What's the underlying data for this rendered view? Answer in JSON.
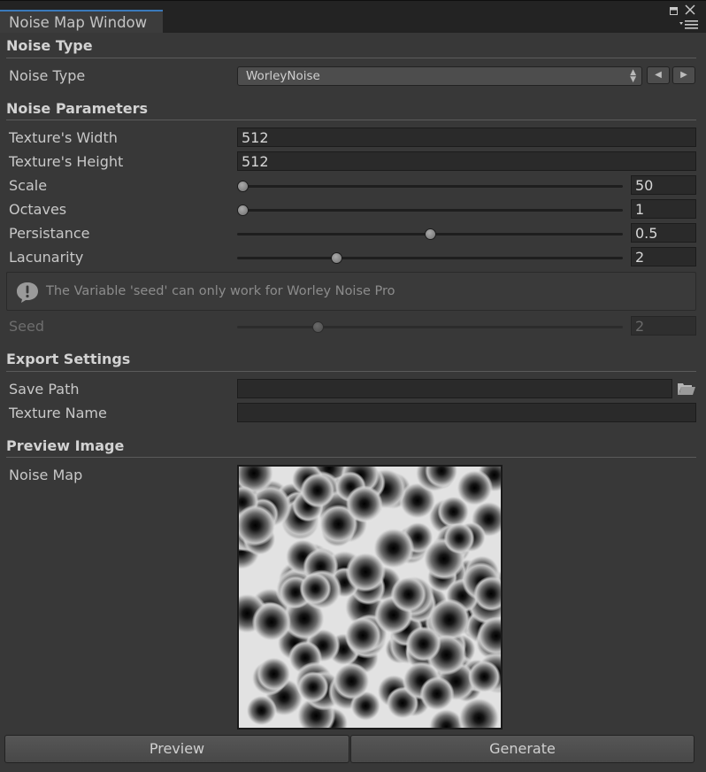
{
  "window": {
    "title": "Noise Map Window"
  },
  "noise_type_section": {
    "header": "Noise Type",
    "label": "Noise Type",
    "selected": "WorleyNoise"
  },
  "parameters_section": {
    "header": "Noise Parameters",
    "width_label": "Texture's Width",
    "width_value": "512",
    "height_label": "Texture's Height",
    "height_value": "512",
    "scale_label": "Scale",
    "scale_value": "50",
    "scale_fraction": 0.0,
    "octaves_label": "Octaves",
    "octaves_value": "1",
    "octaves_fraction": 0.0,
    "persistance_label": "Persistance",
    "persistance_value": "0.5",
    "persistance_fraction": 0.5,
    "lacunarity_label": "Lacunarity",
    "lacunarity_value": "2",
    "lacunarity_fraction": 0.25,
    "help_message": "The Variable 'seed' can only work for Worley Noise Pro",
    "seed_label": "Seed",
    "seed_value": "2",
    "seed_fraction": 0.2
  },
  "export_section": {
    "header": "Export Settings",
    "save_path_label": "Save Path",
    "save_path_value": "",
    "texture_name_label": "Texture Name",
    "texture_name_value": ""
  },
  "preview_section": {
    "header": "Preview Image",
    "label": "Noise Map"
  },
  "buttons": {
    "preview": "Preview",
    "generate": "Generate"
  },
  "colors": {
    "background": "#383838",
    "tab_accent": "#3a79bb",
    "field": "#2a2a2a"
  },
  "icons": [
    "maximize-icon",
    "close-icon",
    "menu-icon",
    "warning-icon",
    "folder-icon",
    "arrow-left-icon",
    "arrow-right-icon"
  ]
}
